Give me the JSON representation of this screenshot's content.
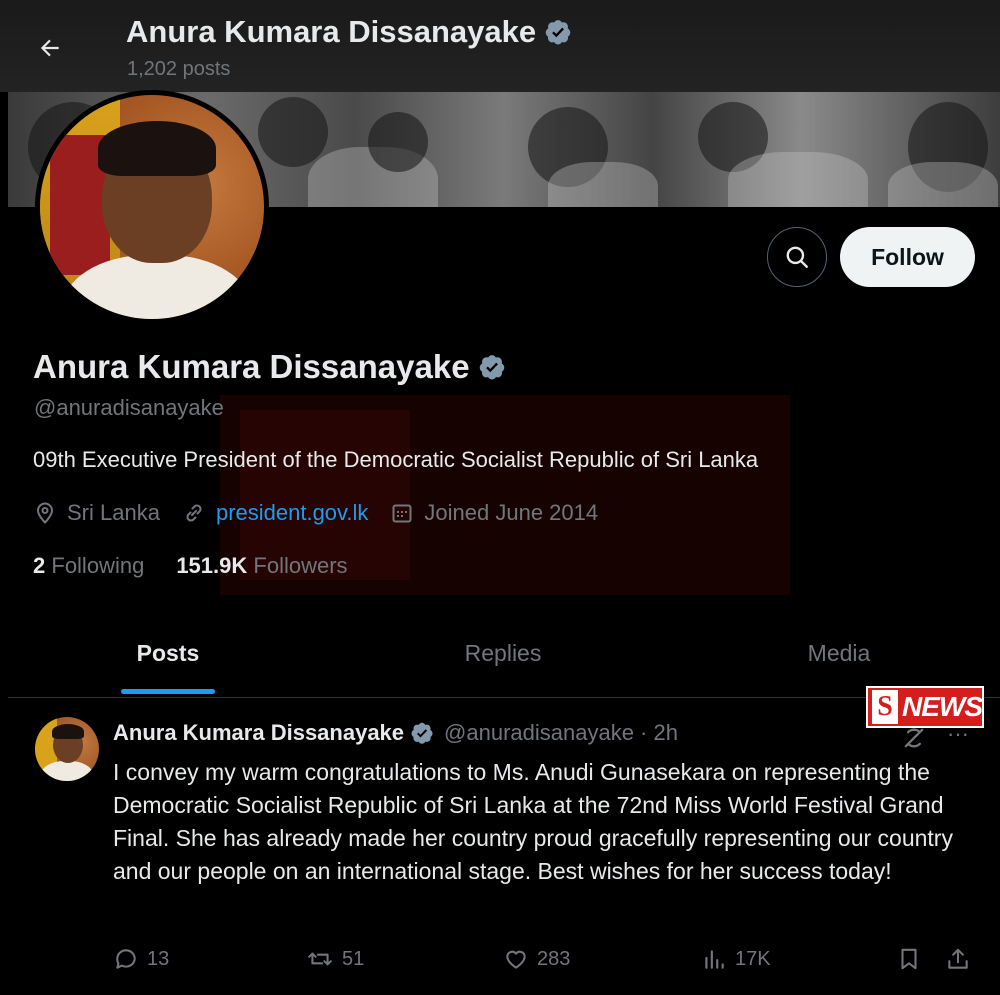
{
  "header": {
    "title": "Anura Kumara Dissanayake",
    "post_count": "1,202 posts"
  },
  "profile": {
    "name": "Anura Kumara Dissanayake",
    "handle": "@anuradisanayake",
    "bio": "09th Executive President of the Democratic Socialist Republic of Sri Lanka",
    "location": "Sri Lanka",
    "website": "president.gov.lk",
    "joined": "Joined June 2014",
    "following_count": "2",
    "following_label": "Following",
    "followers_count": "151.9K",
    "followers_label": "Followers",
    "follow_label": "Follow"
  },
  "tabs": [
    {
      "label": "Posts",
      "active": true
    },
    {
      "label": "Replies",
      "active": false
    },
    {
      "label": "Media",
      "active": false
    }
  ],
  "badge": {
    "s": "S",
    "text": "NEWS"
  },
  "post": {
    "author": "Anura Kumara Dissanayake",
    "handle_time": "@anuradisanayake · 2h",
    "text": "I convey my warm congratulations to Ms. Anudi Gunasekara on representing the Democratic Socialist Republic of Sri Lanka at the 72nd Miss World Festival Grand Final. She has already made her country proud gracefully representing our country and our people on an international stage. Best wishes for her success today!",
    "replies": "13",
    "reposts": "51",
    "likes": "283",
    "views": "17K"
  },
  "colors": {
    "background": "#000000",
    "text": "#e7e9ea",
    "muted": "#71767b",
    "accent": "#1d9bf0",
    "badge_red": "#d41e1e"
  },
  "icons": [
    "back-arrow-icon",
    "verified-icon",
    "search-icon",
    "location-icon",
    "link-icon",
    "calendar-icon",
    "more-icon",
    "grok-icon",
    "reply-icon",
    "repost-icon",
    "like-icon",
    "views-icon",
    "bookmark-icon",
    "share-icon"
  ]
}
